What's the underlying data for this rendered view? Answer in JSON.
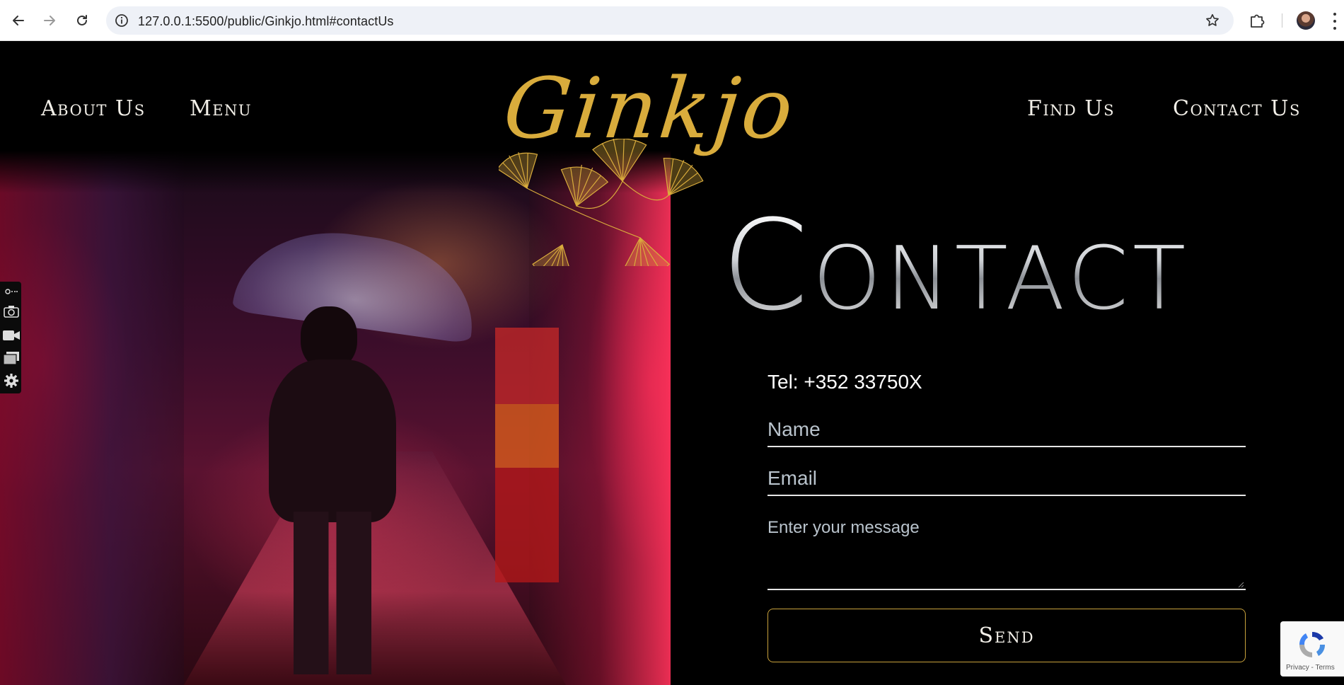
{
  "browser": {
    "url": "127.0.0.1:5500/public/Ginkjo.html#contactUs",
    "icons": {
      "back": "arrow-left-icon",
      "forward": "arrow-right-icon",
      "reload": "reload-icon",
      "site_info": "info-icon",
      "bookmark": "star-icon",
      "extensions": "puzzle-icon",
      "profile": "avatar",
      "menu": "kebab-icon"
    }
  },
  "nav": {
    "about": "About Us",
    "menu": "Menu",
    "find": "Find Us",
    "contact": "Contact Us"
  },
  "logo": {
    "text": "Ginkjo",
    "color": "#d9ac3c"
  },
  "contact": {
    "heading": "Contact",
    "tel": "Tel: +352 33750X",
    "name_placeholder": "Name",
    "email_placeholder": "Email",
    "message_placeholder": "Enter your message",
    "send_label": "Send",
    "accent_color": "#c9a23c"
  },
  "recaptcha": {
    "terms": "Privacy - Terms"
  }
}
